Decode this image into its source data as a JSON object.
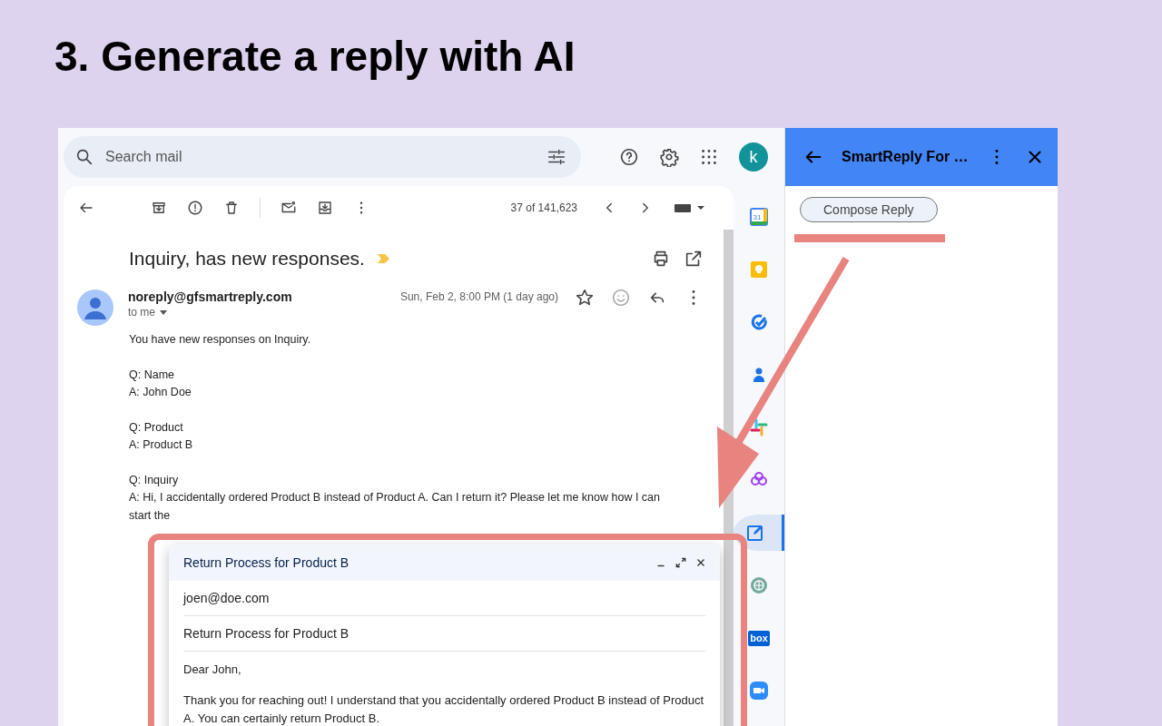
{
  "slide_title": "3. Generate a reply with AI",
  "search": {
    "placeholder": "Search mail"
  },
  "avatar_letter": "k",
  "toolbar": {
    "count": "37 of 141,623"
  },
  "message": {
    "subject": "Inquiry, has new responses.",
    "sender": "noreply@gfsmartreply.com",
    "recipient": "to me",
    "date": "Sun, Feb 2, 8:00 PM (1 day ago)",
    "starred": false,
    "body": [
      [
        "You have new responses on Inquiry."
      ],
      [
        "Q: Name",
        "A: John Doe"
      ],
      [
        "Q: Product",
        "A: Product B"
      ],
      [
        "Q: Inquiry",
        "A: Hi, I accidentally ordered Product B instead of Product A. Can I return it? Please let me know how I can",
        "start the"
      ]
    ]
  },
  "compose": {
    "title": "Return Process for Product B",
    "to": "joen@doe.com",
    "subject": "Return Process for Product B",
    "body": [
      "Dear John,",
      "Thank you for reaching out! I understand that you accidentally ordered Product B instead of Product A. You can certainly return Product B."
    ]
  },
  "apps": [
    {
      "kind": "calendar",
      "label": "31",
      "selected": false
    },
    {
      "kind": "keep",
      "selected": false
    },
    {
      "kind": "tasks",
      "selected": false
    },
    {
      "kind": "contacts",
      "selected": false
    },
    {
      "kind": "slack",
      "selected": false
    },
    {
      "kind": "flower",
      "selected": false
    },
    {
      "kind": "edit",
      "selected": true
    },
    {
      "kind": "knot",
      "selected": false
    },
    {
      "kind": "box",
      "label": "box",
      "selected": false
    },
    {
      "kind": "video",
      "selected": false
    }
  ],
  "addon": {
    "title": "SmartReply For …",
    "button": "Compose Reply"
  }
}
